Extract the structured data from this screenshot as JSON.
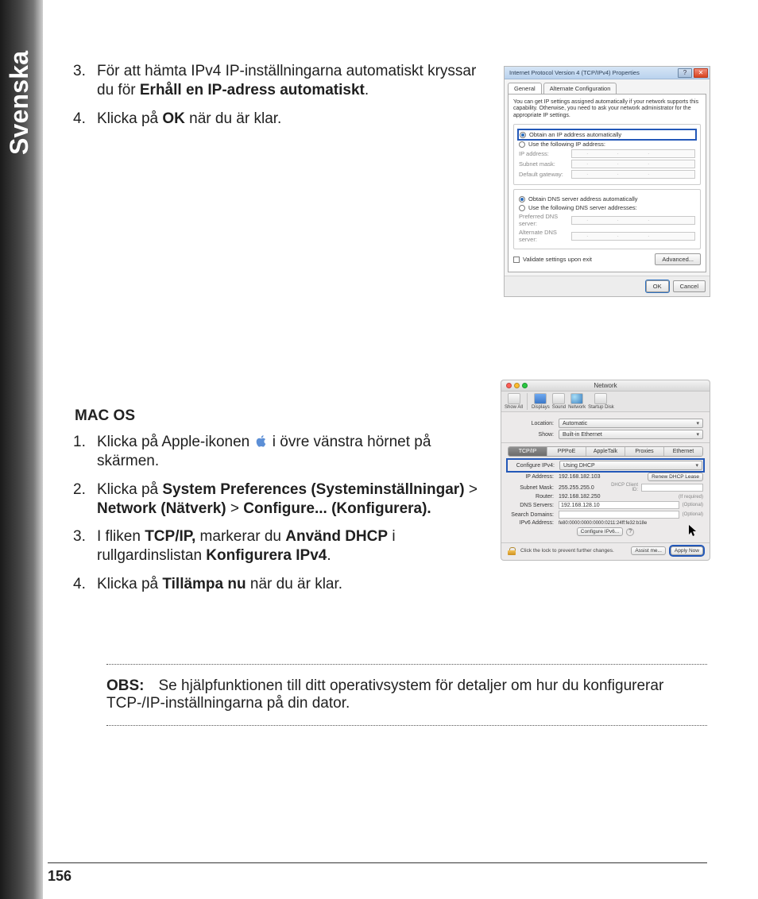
{
  "sidebar_label": "Svenska",
  "page_number": "156",
  "instructions_top": {
    "item3": {
      "num": "3.",
      "pre": "För att hämta IPv4 IP-inställningarna automatiskt kryssar du för ",
      "bold": "Erhåll en IP-adress automatiskt",
      "post": "."
    },
    "item4": {
      "num": "4.",
      "pre": "Klicka på ",
      "bold": "OK",
      "post": "  när du är klar."
    }
  },
  "mac_heading": "MAC OS",
  "mac_steps": {
    "s1": {
      "num": "1.",
      "pre": "Klicka på Apple-ikonen ",
      "post": " i övre vänstra hörnet på skärmen."
    },
    "s2": {
      "num": "2.",
      "pre": "Klicka på ",
      "b1": "System Preferences (Systeminställningar)",
      "mid": " > ",
      "b2": "Network (Nätverk)",
      "mid2": " > ",
      "b3": "Configure... (Konfigurera)."
    },
    "s3": {
      "num": "3.",
      "pre": "I fliken ",
      "b1": "TCP/IP,",
      "mid": " markerar du ",
      "b2": "Använd DHCP",
      "mid2": " i rullgardinslistan ",
      "b3": "Konfigurera IPv4",
      "post": "."
    },
    "s4": {
      "num": "4.",
      "pre": "Klicka på ",
      "b1": "Tillämpa nu",
      "post": " när du är klar."
    }
  },
  "note": {
    "label": "OBS:",
    "text": "Se hjälpfunktionen till ditt operativsystem för detaljer om hur du konfigurerar TCP-/IP-inställningarna på din dator."
  },
  "win": {
    "title": "Internet Protocol Version 4 (TCP/IPv4) Properties",
    "tab_general": "General",
    "tab_alt": "Alternate Configuration",
    "desc": "You can get IP settings assigned automatically if your network supports this capability. Otherwise, you need to ask your network administrator for the appropriate IP settings.",
    "r_auto_ip": "Obtain an IP address automatically",
    "r_use_ip": "Use the following IP address:",
    "lbl_ip": "IP address:",
    "lbl_mask": "Subnet mask:",
    "lbl_gw": "Default gateway:",
    "r_auto_dns": "Obtain DNS server address automatically",
    "r_use_dns": "Use the following DNS server addresses:",
    "lbl_pdns": "Preferred DNS server:",
    "lbl_adns": "Alternate DNS server:",
    "chk_validate": "Validate settings upon exit",
    "btn_adv": "Advanced...",
    "btn_ok": "OK",
    "btn_cancel": "Cancel"
  },
  "mac": {
    "title": "Network",
    "tb": {
      "showall": "Show All",
      "displays": "Displays",
      "sound": "Sound",
      "network": "Network",
      "startup": "Startup Disk"
    },
    "location_lbl": "Location:",
    "location_val": "Automatic",
    "show_lbl": "Show:",
    "show_val": "Built-in Ethernet",
    "tabs": {
      "tcpip": "TCP/IP",
      "pppoe": "PPPoE",
      "appletalk": "AppleTalk",
      "proxies": "Proxies",
      "ethernet": "Ethernet"
    },
    "cfg_lbl": "Configure IPv4:",
    "cfg_val": "Using DHCP",
    "ip_lbl": "IP Address:",
    "ip_val": "192.168.182.103",
    "mask_lbl": "Subnet Mask:",
    "mask_val": "255.255.255.0",
    "router_lbl": "Router:",
    "router_val": "192.168.182.250",
    "dhcpid_lbl": "DHCP Client ID:",
    "dhcpid_hint": "(If required)",
    "dns_lbl": "DNS Servers:",
    "dns_val": "192.168.128.10",
    "sd_lbl": "Search Domains:",
    "v6_lbl": "IPv6 Address:",
    "v6_val": "fe80:0000:0000:0000:0211:24ff:fe32:b18e",
    "opt": "(Optional)",
    "renew": "Renew DHCP Lease",
    "cfg6": "Configure IPv6...",
    "lock_txt": "Click the lock to prevent further changes.",
    "assist": "Assist me...",
    "apply": "Apply Now"
  }
}
